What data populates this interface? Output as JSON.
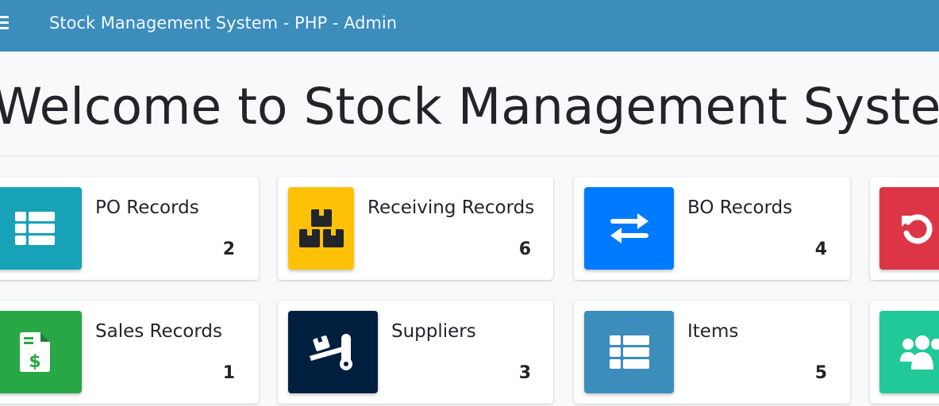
{
  "header": {
    "title": "Stock Management System - PHP - Admin",
    "menu_icon": "hamburger-menu-icon",
    "background": "#3c8dbc"
  },
  "page": {
    "title": "Welcome to Stock Management System -"
  },
  "cards": [
    {
      "label": "PO Records",
      "count": "2",
      "icon": "table-list-icon",
      "color": "#17a2b8"
    },
    {
      "label": "Receiving Records",
      "count": "6",
      "icon": "boxes-icon",
      "color": "#ffc107"
    },
    {
      "label": "BO Records",
      "count": "4",
      "icon": "exchange-arrows-icon",
      "color": "#007bff"
    },
    {
      "label": "",
      "count": "",
      "icon": "undo-icon",
      "color": "#dc3545"
    },
    {
      "label": "Sales Records",
      "count": "1",
      "icon": "file-invoice-dollar-icon",
      "color": "#28a745"
    },
    {
      "label": "Suppliers",
      "count": "3",
      "icon": "dolly-icon",
      "color": "#001f3f"
    },
    {
      "label": "Items",
      "count": "5",
      "icon": "table-list-icon",
      "color": "#3c8dbc"
    },
    {
      "label": "",
      "count": "",
      "icon": "users-icon",
      "color": "#20c997"
    }
  ]
}
